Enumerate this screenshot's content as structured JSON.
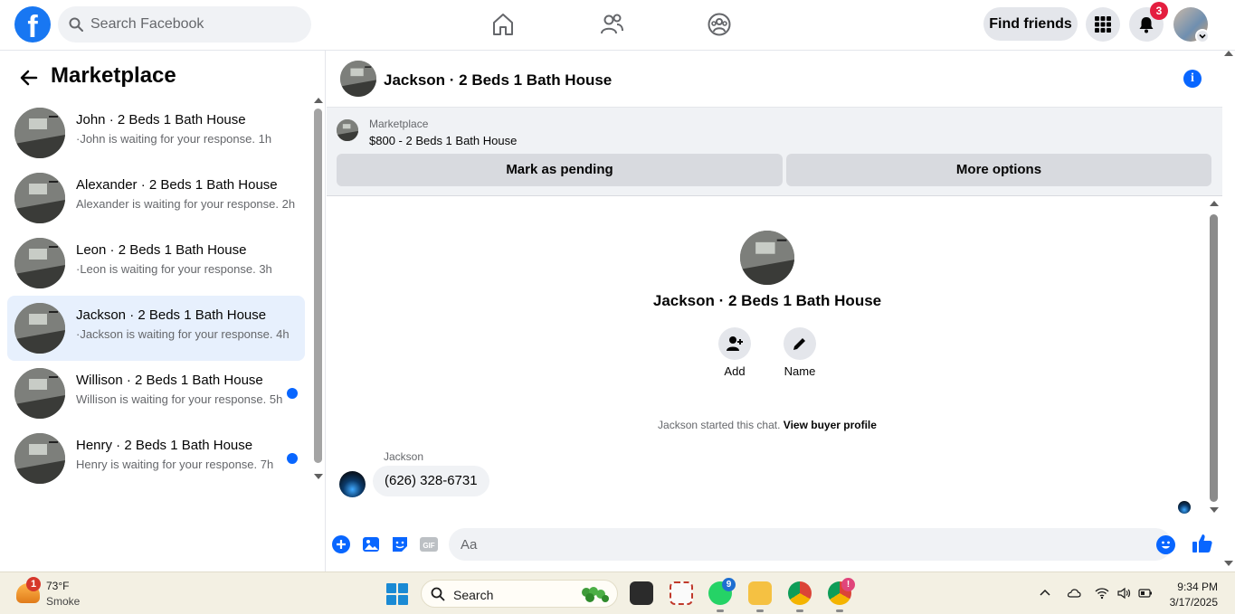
{
  "topbar": {
    "search_placeholder": "Search Facebook",
    "find_friends_label": "Find friends",
    "notifications_count": "3"
  },
  "sidebar": {
    "title": "Marketplace",
    "conversations": [
      {
        "title": "John · 2 Beds 1 Bath House",
        "subtitle": "·John is waiting for your response. 1h",
        "unread": false,
        "active": false
      },
      {
        "title": "Alexander · 2 Beds 1 Bath House",
        "subtitle": "Alexander is waiting for your response. 2h",
        "unread": false,
        "active": false
      },
      {
        "title": "Leon · 2 Beds 1 Bath House",
        "subtitle": "·Leon is waiting for your response. 3h",
        "unread": false,
        "active": false
      },
      {
        "title": "Jackson · 2 Beds 1 Bath House",
        "subtitle": "·Jackson is waiting for your response. 4h",
        "unread": false,
        "active": true
      },
      {
        "title": "Willison · 2 Beds 1 Bath House",
        "subtitle": "Willison is waiting for your response. 5h",
        "unread": true,
        "active": false
      },
      {
        "title": "Henry · 2 Beds 1 Bath House",
        "subtitle": "Henry is waiting for your response. 7h",
        "unread": true,
        "active": false
      }
    ]
  },
  "chat": {
    "header_title": "Jackson · 2 Beds 1 Bath House",
    "listing_label": "Marketplace",
    "listing_price": "$800 - 2 Beds 1 Bath House",
    "mark_pending_label": "Mark as pending",
    "more_options_label": "More options",
    "center_title": "Jackson · 2 Beds 1 Bath House",
    "add_label": "Add",
    "name_label": "Name",
    "started_text": "Jackson started this chat.",
    "view_profile_label": "View buyer profile",
    "sender_name": "Jackson",
    "message_text": "(626) 328-6731",
    "composer_placeholder": "Aa",
    "accent_color": "#0866ff"
  },
  "taskbar": {
    "weather_badge": "1",
    "weather_temp": "73°F",
    "weather_desc": "Smoke",
    "search_label": "Search",
    "whatsapp_badge": "9",
    "chrome_badge": "!",
    "time": "9:34 PM",
    "date": "3/17/2025"
  }
}
